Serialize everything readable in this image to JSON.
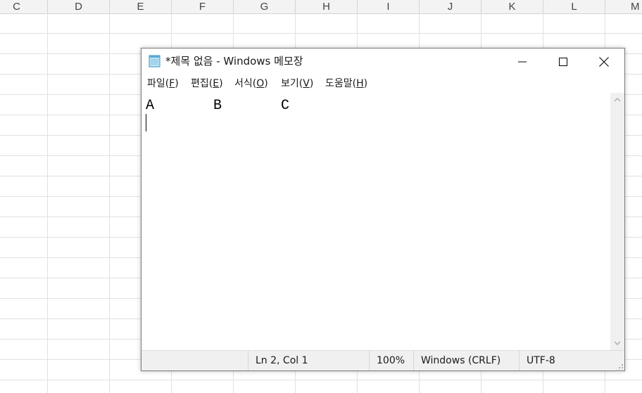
{
  "spreadsheet": {
    "columns": [
      "C",
      "D",
      "E",
      "F",
      "G",
      "H",
      "I",
      "J",
      "K",
      "L",
      "M"
    ]
  },
  "notepad": {
    "title": "*제목 없음 - Windows 메모장",
    "icon": "notepad-icon",
    "menu": [
      {
        "label": "파일(",
        "key": "F",
        "close": ")"
      },
      {
        "label": "편집(",
        "key": "E",
        "close": ")"
      },
      {
        "label": "서식(",
        "key": "O",
        "close": ")"
      },
      {
        "label": "보기(",
        "key": "V",
        "close": ")"
      },
      {
        "label": "도움말(",
        "key": "H",
        "close": ")"
      }
    ],
    "content": "A       B       C",
    "status": {
      "position": "Ln 2, Col 1",
      "zoom": "100%",
      "line_ending": "Windows (CRLF)",
      "encoding": "UTF-8"
    }
  }
}
